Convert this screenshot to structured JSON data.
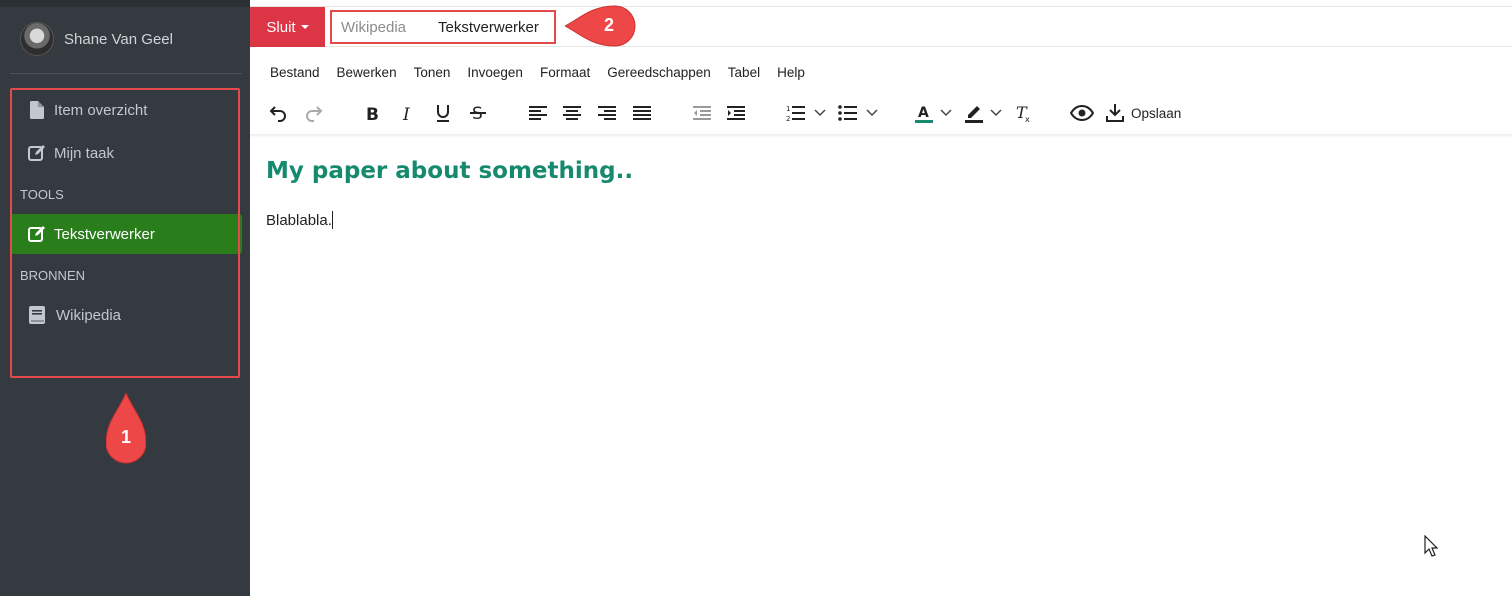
{
  "user": {
    "name": "Shane Van Geel"
  },
  "sidebar": {
    "items": [
      {
        "label": "Item overzicht",
        "icon": "file-icon"
      },
      {
        "label": "Mijn taak",
        "icon": "edit-icon"
      }
    ],
    "tools_header": "TOOLS",
    "tools": [
      {
        "label": "Tekstverwerker",
        "icon": "edit-icon",
        "active": true
      }
    ],
    "sources_header": "BRONNEN",
    "sources": [
      {
        "label": "Wikipedia",
        "icon": "book-icon"
      }
    ]
  },
  "annotations": {
    "marker_1": "1",
    "marker_2": "2",
    "color": "#e44a4a"
  },
  "topbar": {
    "close_label": "Sluit",
    "tabs": [
      {
        "label": "Wikipedia",
        "active": false
      },
      {
        "label": "Tekstverwerker",
        "active": true
      }
    ]
  },
  "menubar": {
    "items": [
      "Bestand",
      "Bewerken",
      "Tonen",
      "Invoegen",
      "Formaat",
      "Gereedschappen",
      "Tabel",
      "Help"
    ]
  },
  "toolbar": {
    "buttons": [
      "undo",
      "redo",
      "bold",
      "italic",
      "underline",
      "strikethrough",
      "align-left",
      "align-center",
      "align-right",
      "justify",
      "outdent",
      "indent",
      "numbered-list",
      "bullet-list",
      "text-color",
      "highlight",
      "clear-formatting",
      "preview",
      "save"
    ],
    "save_label": "Opslaan"
  },
  "document": {
    "title": "My paper about something..",
    "body": "Blablabla.",
    "title_color": "#168a6e"
  },
  "colors": {
    "sidebar": "#343a40",
    "active": "#2a7d1b",
    "close": "#dc3545"
  }
}
